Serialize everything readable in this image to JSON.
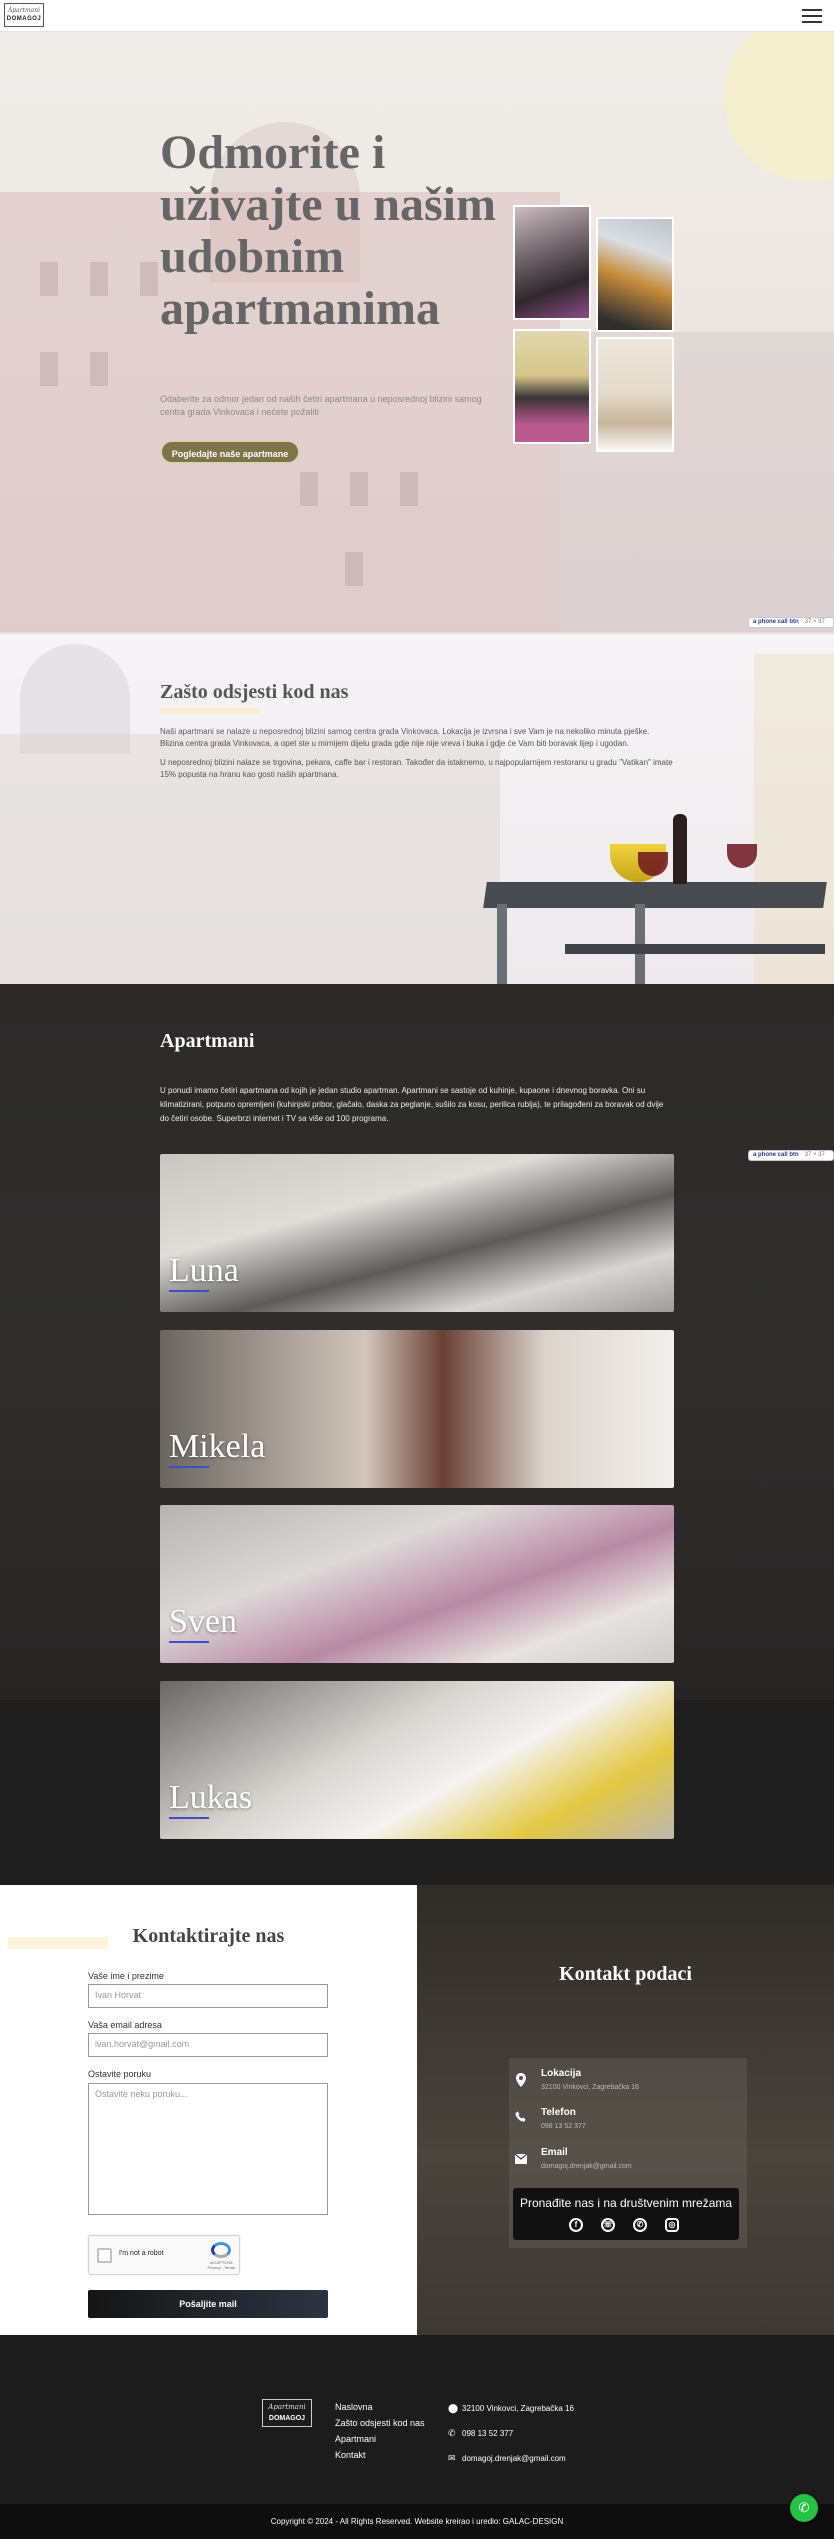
{
  "header": {
    "logo_line1": "Apartmani",
    "logo_line2": "DOMAGOJ",
    "menu_icon": "hamburger-icon"
  },
  "hero": {
    "title": "Odmorite i uživajte u našim udobnim apartmanima",
    "subtitle": "Odaberite za odmor jedan od naših četiri apartmana u neposrednoj blizini samog centra grada Vinkovaca i nećete požaliti",
    "cta_label": "Pogledajte naše apartmane"
  },
  "call_badge": {
    "label": "a phone call btn",
    "count": "37 × 37"
  },
  "why": {
    "title": "Zašto odsjesti kod nas",
    "p1": "Naši apartmani se nalaze u neposrednoj blizini samog centra grada Vinkovaca. Lokacija je izvrsna i sve Vam je na nekoliko minuta pješke. Blizina centra grada Vinkovaca, a opet ste u mirnijem dijelu grada gdje nije nije vreva i buka i gdje će Vam biti boravak lijep i ugodan.",
    "p2": "U neposrednoj blizini nalaze se trgovina, pekara, caffe bar i restoran. Također da istaknemo, u najpopularnijem restoranu u gradu \"Vatikan\" imate 15% popusta na hranu kao gosti naših apartmana."
  },
  "apartments": {
    "title": "Apartmani",
    "text": "U ponudi imamo četiri apartmana od kojih je jedan studio apartman. Apartmani se sastoje od kuhinje, kupaone i dnevnog boravka. Oni su klimatizirani, potpuno opremljeni (kuhinjski pribor, glačalo, daska za peglanje, sušilo za kosu, perilica rublja), te prilagođeni za boravak od dvije do četiri osobe. Superbrzi internet i TV sa više od 100 programa.",
    "items": [
      {
        "name": "Luna"
      },
      {
        "name": "Mikela"
      },
      {
        "name": "Sven"
      },
      {
        "name": "Lukas"
      }
    ]
  },
  "contact_form": {
    "title": "Kontaktirajte nas",
    "name_label": "Vaše ime i prezime",
    "name_placeholder": "Ivan Horvat",
    "email_label": "Vaša email adresa",
    "email_placeholder": "ivan.horvat@gmail.com",
    "message_label": "Ostavite poruku",
    "message_placeholder": "Ostavite neku poruku...",
    "recaptcha_label": "I'm not a robot",
    "recaptcha_brand": "reCAPTCHA",
    "recaptcha_links": "Privacy - Terms",
    "submit_label": "Pošaljite mail"
  },
  "contact_info": {
    "title": "Kontakt podaci",
    "location_title": "Lokacija",
    "location_value": "32100 Vinkovci, Zagrebačka 16",
    "phone_title": "Telefon",
    "phone_value": "098 13 52 377",
    "email_title": "Email",
    "email_value": "domagoj.drenjak@gmail.com",
    "social_title": "Pronađite nas i na društvenim mrežama",
    "social_icons": [
      "facebook-icon",
      "whatsapp-icon",
      "viber-icon",
      "instagram-icon"
    ]
  },
  "footer": {
    "logo_line1": "Apartmani",
    "logo_line2": "DOMAGOJ",
    "nav": [
      "Naslovna",
      "Zašto odsjesti kod nas",
      "Apartmani",
      "Kontakt"
    ],
    "address": "32100 Vinkovci, Zagrebačka 16",
    "phone": "098 13 52 377",
    "email": "domagoj.drenjak@gmail.com",
    "copyright": "Copyright © 2024 - All Rights Reserved. Website kreirao i uredio: GALAC-DESIGN"
  },
  "colors": {
    "accent": "#7d7447",
    "dark": "#1e1e1e",
    "whatsapp": "#25c244"
  }
}
